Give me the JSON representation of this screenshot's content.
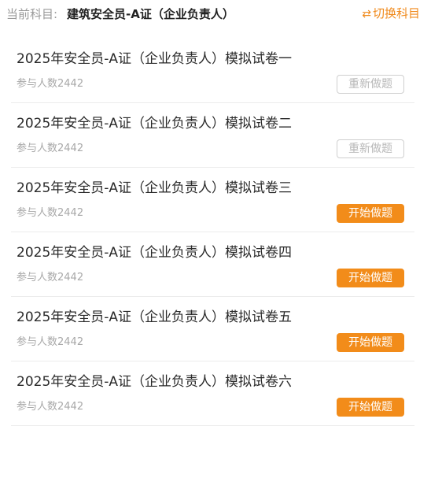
{
  "header": {
    "label": "当前科目:",
    "subject": "建筑安全员-A证（企业负责人）",
    "switch_icon": "⇄",
    "switch_label": "切换科目",
    "accent_color": "#f28c1a"
  },
  "exams": [
    {
      "title": "2025年安全员-A证（企业负责人）模拟试卷一",
      "participants": "参与人数2442",
      "action": "重新做题",
      "state": "redo"
    },
    {
      "title": "2025年安全员-A证（企业负责人）模拟试卷二",
      "participants": "参与人数2442",
      "action": "重新做题",
      "state": "redo"
    },
    {
      "title": "2025年安全员-A证（企业负责人）模拟试卷三",
      "participants": "参与人数2442",
      "action": "开始做题",
      "state": "start"
    },
    {
      "title": "2025年安全员-A证（企业负责人）模拟试卷四",
      "participants": "参与人数2442",
      "action": "开始做题",
      "state": "start"
    },
    {
      "title": "2025年安全员-A证（企业负责人）模拟试卷五",
      "participants": "参与人数2442",
      "action": "开始做题",
      "state": "start"
    },
    {
      "title": "2025年安全员-A证（企业负责人）模拟试卷六",
      "participants": "参与人数2442",
      "action": "开始做题",
      "state": "start"
    }
  ]
}
